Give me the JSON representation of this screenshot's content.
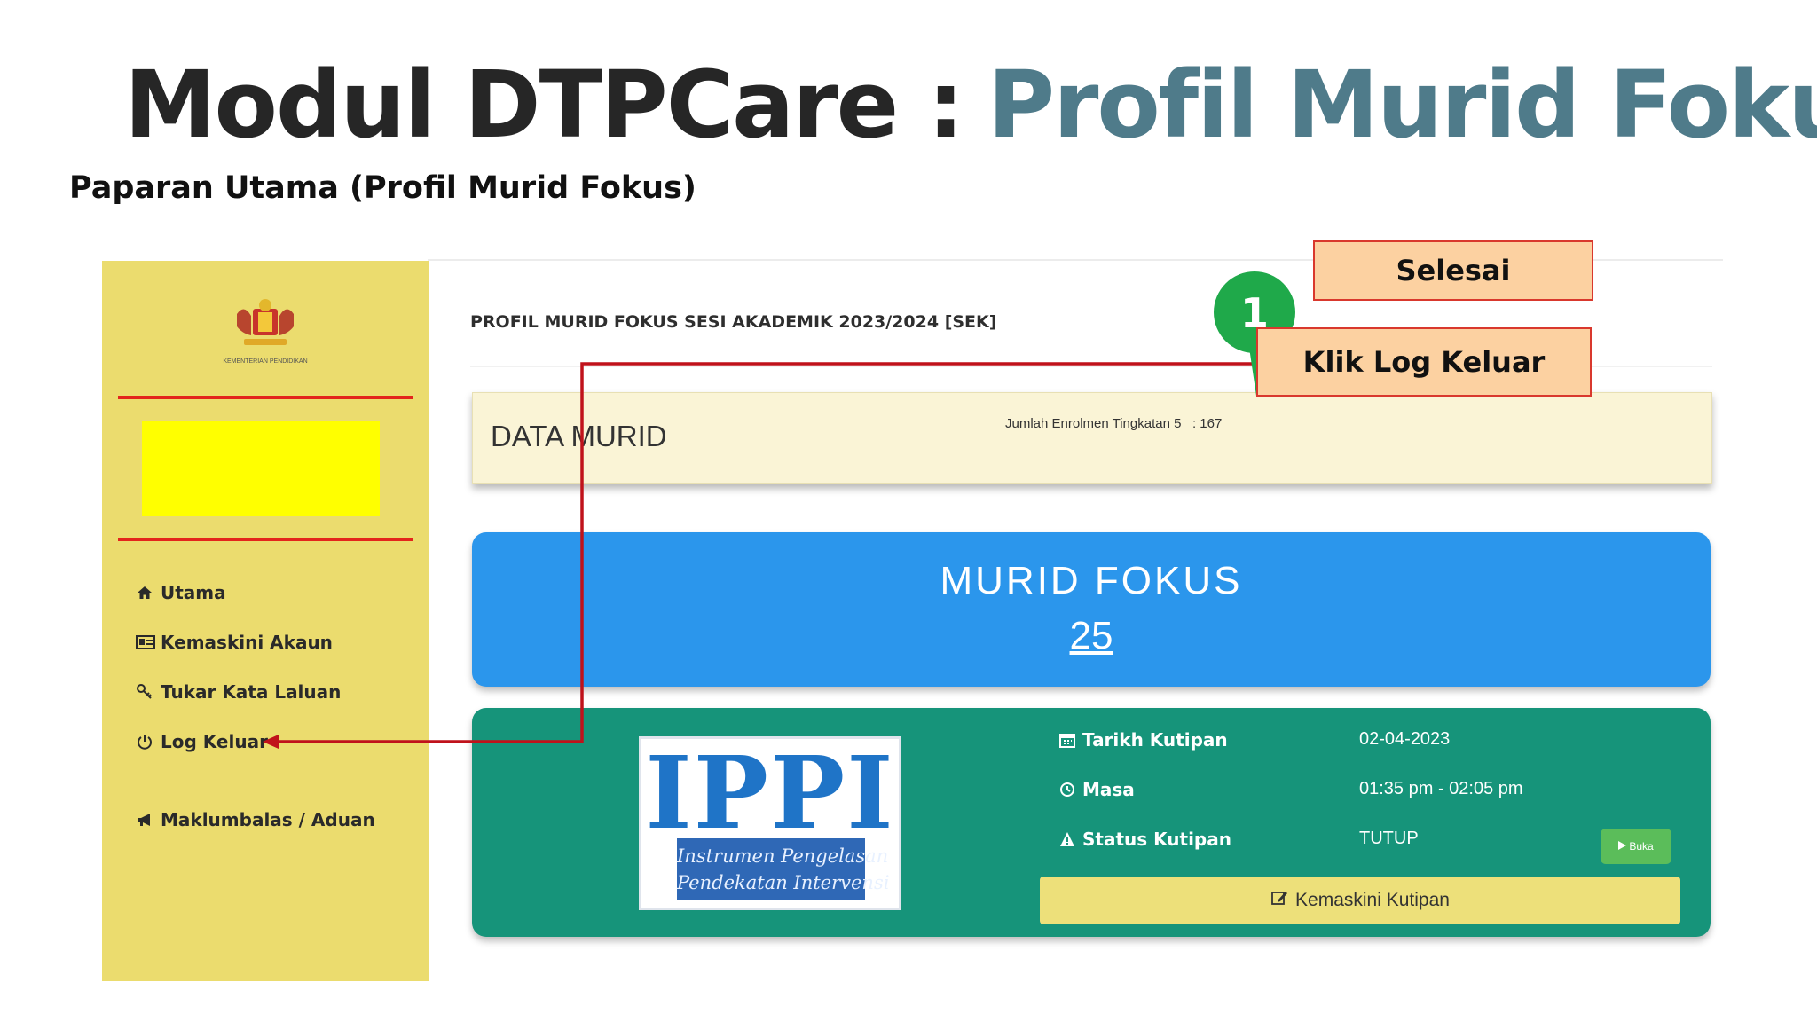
{
  "slide": {
    "title_part1": "Modul DTPCare :",
    "title_part2": "Profil Murid Fokus",
    "subtitle": "Paparan Utama (Profil Murid Fokus)"
  },
  "sidebar": {
    "items": [
      {
        "label": "Utama",
        "icon": "home-icon"
      },
      {
        "label": "Kemaskini Akaun",
        "icon": "id-card-icon"
      },
      {
        "label": "Tukar Kata Laluan",
        "icon": "key-icon"
      },
      {
        "label": "Log Keluar",
        "icon": "power-icon"
      },
      {
        "label": "Maklumbalas / Aduan",
        "icon": "megaphone-icon"
      }
    ]
  },
  "page": {
    "header": "PROFIL MURID FOKUS SESI AKADEMIK 2023/2024 [SEK]",
    "data_murid": {
      "title": "DATA MURID",
      "enrolment_label": "Jumlah Enrolmen Tingkatan 5",
      "enrolment_value": ": 167"
    },
    "murid_fokus": {
      "label": "MURID FOKUS",
      "count": "25"
    },
    "ippi": {
      "logo_word": "IPPI",
      "logo_sub_line1": "Instrumen Pengelasan",
      "logo_sub_line2": "Pendekatan Intervensi",
      "rows": [
        {
          "label": "Tarikh Kutipan",
          "value": "02-04-2023",
          "icon": "calendar-icon"
        },
        {
          "label": "Masa",
          "value": "01:35 pm - 02:05 pm",
          "icon": "clock-icon"
        },
        {
          "label": "Status Kutipan",
          "value": "TUTUP",
          "icon": "warning-icon"
        }
      ],
      "buka_label": "Buka",
      "kemaskini_label": "Kemaskini Kutipan"
    }
  },
  "callouts": {
    "step_number": "1",
    "selesai": "Selesai",
    "klik_log_keluar": "Klik Log Keluar"
  },
  "colors": {
    "sidebar_bg": "#ebdc6e",
    "murid_fokus_bg": "#2b96ec",
    "ippi_card_bg": "#16947a",
    "callout_bg": "#fcd1a1",
    "step_badge": "#1fa94a",
    "arrow": "#c0121b"
  }
}
